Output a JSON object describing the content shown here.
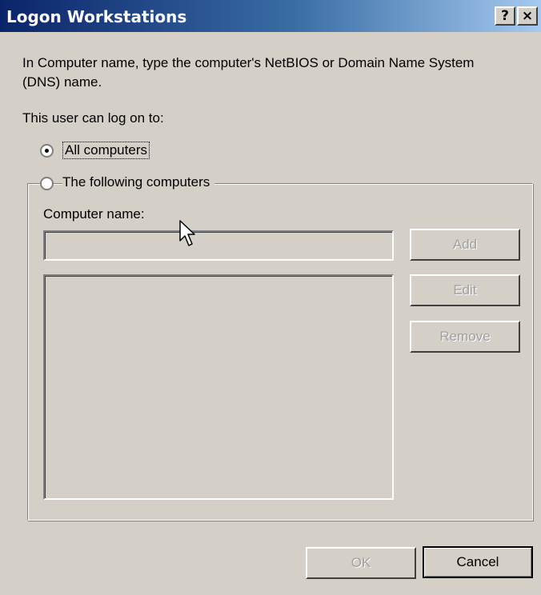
{
  "window": {
    "title": "Logon Workstations",
    "help_glyph": "?",
    "close_glyph": "×"
  },
  "instruction": "In Computer name, type the computer's NetBIOS or Domain Name System (DNS) name.",
  "logon_label": "This user can log on to:",
  "options": {
    "all_computers": {
      "label": "All computers",
      "selected": true
    },
    "following_computers": {
      "label": "The following computers",
      "selected": false
    }
  },
  "computer_name": {
    "label": "Computer name:",
    "value": ""
  },
  "computer_list": [],
  "buttons": {
    "add": "Add",
    "edit": "Edit",
    "remove": "Remove",
    "ok": "OK",
    "cancel": "Cancel"
  },
  "colors": {
    "title_bar_start": "#0a246a",
    "dialog_face": "#d4d0c8",
    "disabled_text": "#a0a0a0"
  },
  "icons": {
    "cursor": "mouse-pointer-icon",
    "help": "help-icon",
    "close": "close-icon"
  }
}
